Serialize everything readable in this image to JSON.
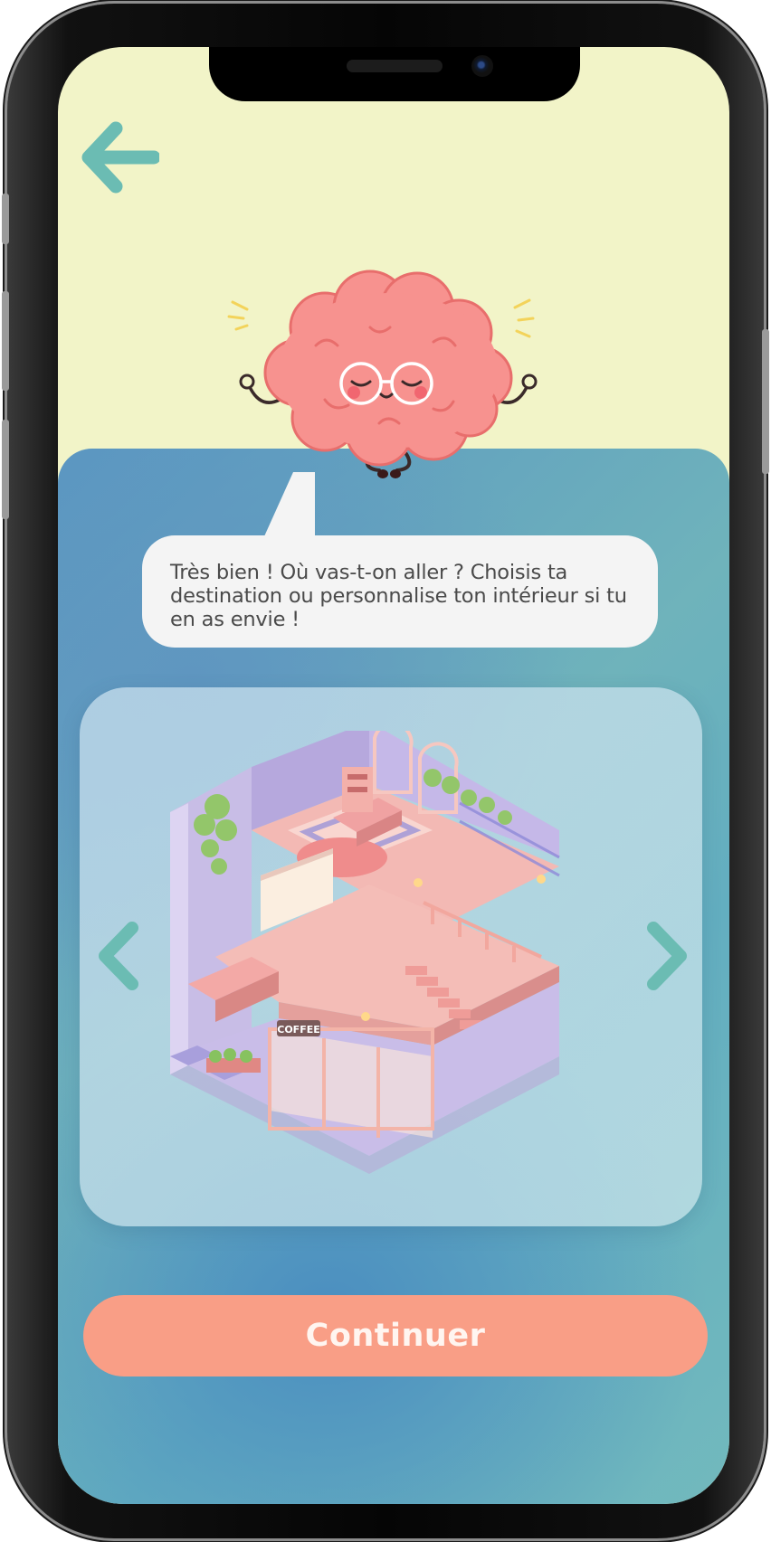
{
  "speech_bubble": {
    "text": "Très bien ! Où vas-t-on aller ? Choisis ta destination ou personnalise ton intérieur si tu en as envie !"
  },
  "carousel": {
    "selected_image": "isometric-pink-house",
    "sign_text": "COFFEE"
  },
  "continue_button": {
    "label": "Continuer"
  },
  "colors": {
    "top_background": "#f2f4c8",
    "accent_teal": "#6bbcb3",
    "button": "#f99e86",
    "brain": "#f7928f",
    "bubble": "#f4f4f4"
  },
  "icons": {
    "back": "arrow-left-icon",
    "prev": "chevron-left-icon",
    "next": "chevron-right-icon"
  }
}
